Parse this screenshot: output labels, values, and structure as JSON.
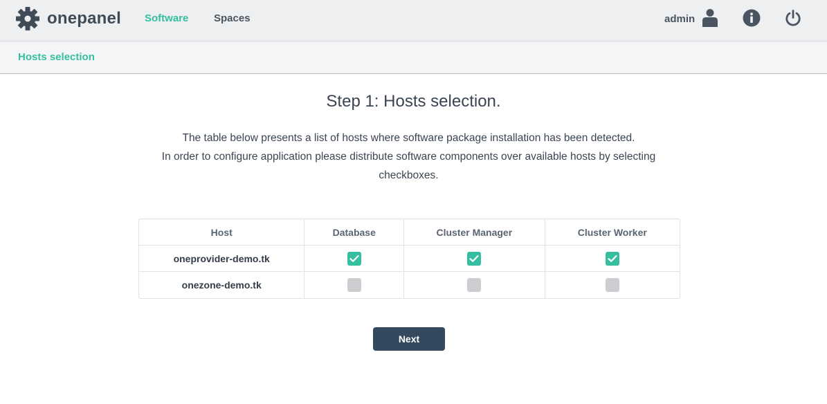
{
  "app": {
    "logo_text": "onepanel",
    "logo_icon": "gear-icon"
  },
  "nav": {
    "items": [
      {
        "label": "Software",
        "active": true
      },
      {
        "label": "Spaces",
        "active": false
      }
    ]
  },
  "user": {
    "name": "admin",
    "icons": [
      "user-icon",
      "info-icon",
      "power-icon"
    ]
  },
  "subheader": {
    "title": "Hosts selection"
  },
  "main": {
    "title": "Step 1: Hosts selection.",
    "description_line1": "The table below presents a list of hosts where software package installation has been detected.",
    "description_line2": "In order to configure application please distribute software components over available hosts by selecting checkboxes."
  },
  "table": {
    "columns": [
      "Host",
      "Database",
      "Cluster Manager",
      "Cluster Worker"
    ],
    "rows": [
      {
        "host": "oneprovider-demo.tk",
        "database": true,
        "cluster_manager": true,
        "cluster_worker": true
      },
      {
        "host": "onezone-demo.tk",
        "database": false,
        "cluster_manager": false,
        "cluster_worker": false
      }
    ]
  },
  "actions": {
    "next_label": "Next"
  },
  "colors": {
    "accent": "#35bfa0",
    "button": "#34495e",
    "checkbox_off": "#cbcdd1"
  }
}
